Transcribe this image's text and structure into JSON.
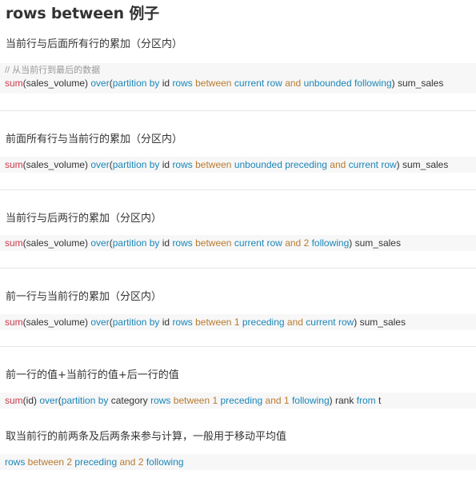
{
  "title": "rows between 例子",
  "colors": {
    "function": "#c93a4a",
    "keyword": "#1a86b8",
    "operator": "#b87a2e",
    "identifier": "#333333"
  },
  "sections": [
    {
      "heading": "当前行与后面所有行的累加（分区内）",
      "comment": "// 从当前行到最后的数据",
      "code": [
        {
          "t": "sum",
          "k": "fn"
        },
        {
          "t": "(sales_volume) ",
          "k": "id"
        },
        {
          "t": "over",
          "k": "kw"
        },
        {
          "t": "(",
          "k": "id"
        },
        {
          "t": "partition by",
          "k": "kw"
        },
        {
          "t": " id ",
          "k": "id"
        },
        {
          "t": "rows",
          "k": "kw"
        },
        {
          "t": " between ",
          "k": "op"
        },
        {
          "t": "current row",
          "k": "kw"
        },
        {
          "t": " and ",
          "k": "op"
        },
        {
          "t": "unbounded following",
          "k": "kw"
        },
        {
          "t": ") sum_sales",
          "k": "id"
        }
      ]
    },
    {
      "heading": "前面所有行与当前行的累加（分区内）",
      "code": [
        {
          "t": "sum",
          "k": "fn"
        },
        {
          "t": "(sales_volume) ",
          "k": "id"
        },
        {
          "t": "over",
          "k": "kw"
        },
        {
          "t": "(",
          "k": "id"
        },
        {
          "t": "partition by",
          "k": "kw"
        },
        {
          "t": " id ",
          "k": "id"
        },
        {
          "t": "rows",
          "k": "kw"
        },
        {
          "t": " between ",
          "k": "op"
        },
        {
          "t": "unbounded preceding",
          "k": "kw"
        },
        {
          "t": " and ",
          "k": "op"
        },
        {
          "t": "current row",
          "k": "kw"
        },
        {
          "t": ") sum_sales",
          "k": "id"
        }
      ]
    },
    {
      "heading": "当前行与后两行的累加（分区内）",
      "code": [
        {
          "t": "sum",
          "k": "fn"
        },
        {
          "t": "(sales_volume) ",
          "k": "id"
        },
        {
          "t": "over",
          "k": "kw"
        },
        {
          "t": "(",
          "k": "id"
        },
        {
          "t": "partition by",
          "k": "kw"
        },
        {
          "t": " id ",
          "k": "id"
        },
        {
          "t": "rows",
          "k": "kw"
        },
        {
          "t": " between ",
          "k": "op"
        },
        {
          "t": "current row",
          "k": "kw"
        },
        {
          "t": " and ",
          "k": "op"
        },
        {
          "t": "2",
          "k": "op"
        },
        {
          "t": " following",
          "k": "kw"
        },
        {
          "t": ") sum_sales",
          "k": "id"
        }
      ]
    },
    {
      "heading": "前一行与当前行的累加（分区内）",
      "code": [
        {
          "t": "sum",
          "k": "fn"
        },
        {
          "t": "(sales_volume) ",
          "k": "id"
        },
        {
          "t": "over",
          "k": "kw"
        },
        {
          "t": "(",
          "k": "id"
        },
        {
          "t": "partition by",
          "k": "kw"
        },
        {
          "t": " id ",
          "k": "id"
        },
        {
          "t": "rows",
          "k": "kw"
        },
        {
          "t": " between ",
          "k": "op"
        },
        {
          "t": "1",
          "k": "op"
        },
        {
          "t": " preceding",
          "k": "kw"
        },
        {
          "t": " and ",
          "k": "op"
        },
        {
          "t": "current row",
          "k": "kw"
        },
        {
          "t": ") sum_sales",
          "k": "id"
        }
      ]
    },
    {
      "heading": "前一行的值+当前行的值+后一行的值",
      "code": [
        {
          "t": "sum",
          "k": "fn"
        },
        {
          "t": "(id) ",
          "k": "id"
        },
        {
          "t": "over",
          "k": "kw"
        },
        {
          "t": "(",
          "k": "id"
        },
        {
          "t": "partition by",
          "k": "kw"
        },
        {
          "t": " category ",
          "k": "id"
        },
        {
          "t": "rows",
          "k": "kw"
        },
        {
          "t": " between ",
          "k": "op"
        },
        {
          "t": "1",
          "k": "op"
        },
        {
          "t": " preceding",
          "k": "kw"
        },
        {
          "t": " and ",
          "k": "op"
        },
        {
          "t": "1",
          "k": "op"
        },
        {
          "t": " following",
          "k": "kw"
        },
        {
          "t": ") rank ",
          "k": "id"
        },
        {
          "t": "from",
          "k": "kw"
        },
        {
          "t": " t",
          "k": "id"
        }
      ]
    },
    {
      "heading": "取当前行的前两条及后两条来参与计算，一般用于移动平均值",
      "code": [
        {
          "t": "rows",
          "k": "kw"
        },
        {
          "t": " between ",
          "k": "op"
        },
        {
          "t": "2",
          "k": "op"
        },
        {
          "t": " preceding",
          "k": "kw"
        },
        {
          "t": " and ",
          "k": "op"
        },
        {
          "t": "2",
          "k": "op"
        },
        {
          "t": " following",
          "k": "kw"
        }
      ]
    }
  ]
}
